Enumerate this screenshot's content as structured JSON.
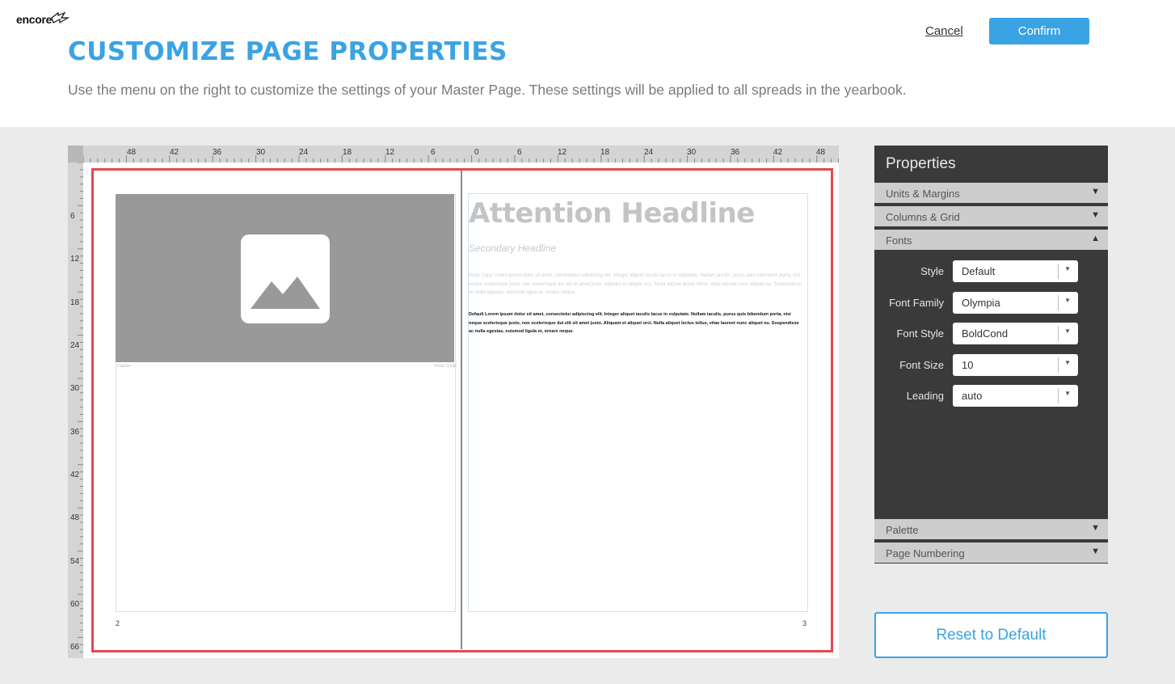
{
  "app": {
    "logo_text": "encore"
  },
  "header": {
    "title": "CUSTOMIZE PAGE PROPERTIES",
    "subtitle": "Use the menu on the right to customize the settings of your Master Page. These settings will be applied to all spreads in the yearbook.",
    "cancel_label": "Cancel",
    "confirm_label": "Confirm"
  },
  "rulers": {
    "top": [
      "48",
      "42",
      "36",
      "30",
      "24",
      "18",
      "12",
      "6",
      "0",
      "6",
      "12",
      "18",
      "24",
      "30",
      "36",
      "42",
      "48"
    ],
    "left": [
      "6",
      "12",
      "18",
      "24",
      "30",
      "36",
      "42",
      "48",
      "54",
      "60",
      "66"
    ]
  },
  "spread": {
    "left_page_number": "2",
    "right_page_number": "3",
    "caption": "Caption",
    "photo_credit": "Photo Credit",
    "headline": "Attention Headline",
    "secondary_headline": "Secondary Headline",
    "body_copy": "Body Copy Lorem ipsum dolor sit amet, consectetur adipiscing elit. Integer aliquet iaculis lacus in vulputate. Nullam iaculis, purus quis bibendum porta, nisi neque scelerisque justo, non scelerisque dui elit sit amet justo. Aliquam et aliquet orci. Nulla aliquet lectus tellus, vitae laoreet nunc aliquet eu. Suspendisse ac nulla egestas, euismod ligula et, ornare neque.",
    "default_copy": "Default Lorem ipsum dolor sit amet, consectetur adipiscing elit. Integer aliquet iaculis lacus in vulputate. Nullam iaculis, purus quis bibendum porta, nisi neque scelerisque justo, non scelerisque dui elit sit amet justo. Aliquam et aliquet orci. Nulla aliquet lectus tellus, vitae laoreet nunc aliquet eu. Suspendisse ac nulla egestas, euismod ligula et, ornare neque."
  },
  "properties": {
    "title": "Properties",
    "sections": [
      {
        "label": "Units & Margins",
        "state": "collapsed",
        "arrow": "▼"
      },
      {
        "label": "Columns & Grid",
        "state": "collapsed",
        "arrow": "▼"
      },
      {
        "label": "Fonts",
        "state": "expanded",
        "arrow": "▲"
      },
      {
        "label": "Palette",
        "state": "collapsed",
        "arrow": "▼"
      },
      {
        "label": "Page Numbering",
        "state": "collapsed",
        "arrow": "▼"
      }
    ],
    "fonts": {
      "style": {
        "label": "Style",
        "value": "Default"
      },
      "font_family": {
        "label": "Font Family",
        "value": "Olympia"
      },
      "font_style": {
        "label": "Font Style",
        "value": "BoldCond"
      },
      "font_size": {
        "label": "Font Size",
        "value": "10"
      },
      "leading": {
        "label": "Leading",
        "value": "auto"
      }
    },
    "caret": "▼"
  },
  "reset_label": "Reset to Default",
  "colors": {
    "accent": "#3aa3e3",
    "spread_border": "#e5484d",
    "panel_bg": "#3a3a3a"
  }
}
